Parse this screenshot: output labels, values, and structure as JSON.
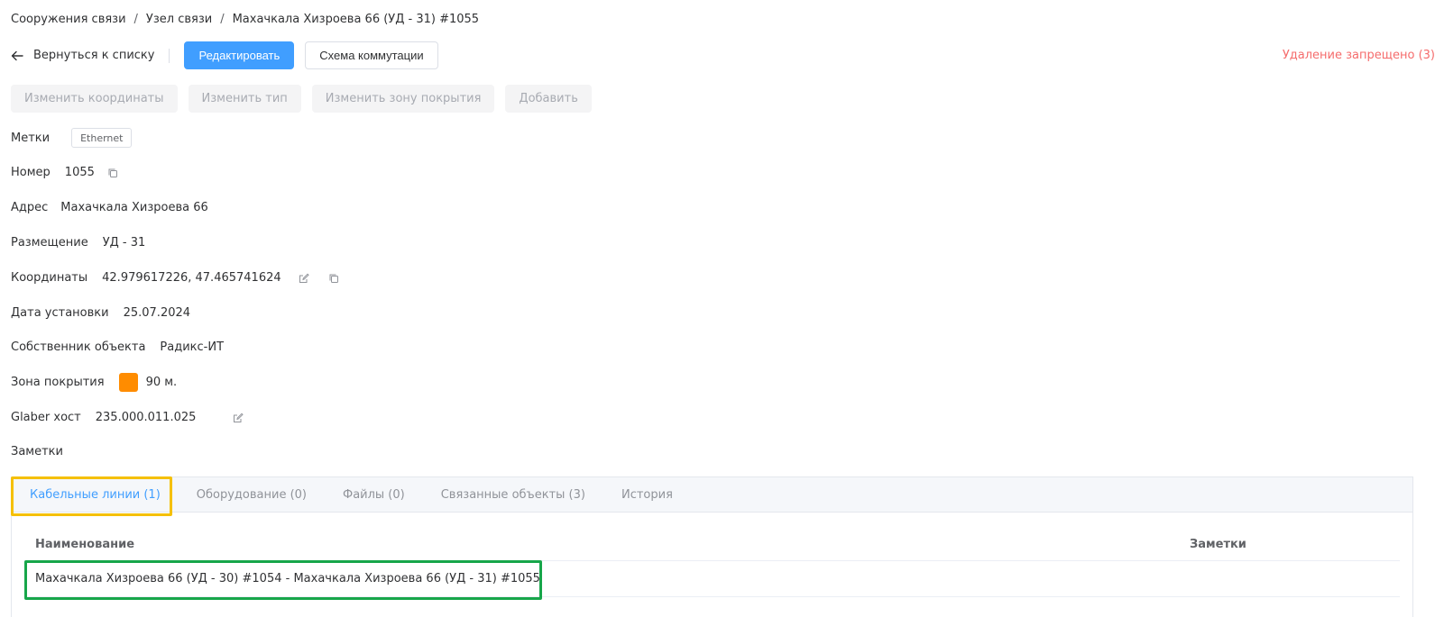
{
  "breadcrumb": {
    "items": [
      "Сооружения связи",
      "Узел связи",
      "Махачкала Хизроева 66 (УД - 31) #1055"
    ],
    "separator": "/"
  },
  "actions": {
    "back_label": "Вернуться к списку",
    "edit_label": "Редактировать",
    "scheme_label": "Схема коммутации",
    "delete_note": "Удаление запрещено (3)"
  },
  "secondary_actions": {
    "change_coords": "Изменить координаты",
    "change_type": "Изменить тип",
    "change_zone": "Изменить зону покрытия",
    "add": "Добавить"
  },
  "fields": {
    "tags": {
      "label": "Метки",
      "value": "Ethernet"
    },
    "number": {
      "label": "Номер",
      "value": "1055"
    },
    "address": {
      "label": "Адрес",
      "value": "Махачкала Хизроева 66"
    },
    "placement": {
      "label": "Размещение",
      "value": "УД - 31"
    },
    "coordinates": {
      "label": "Координаты",
      "value": "42.979617226, 47.465741624"
    },
    "install_date": {
      "label": "Дата установки",
      "value": "25.07.2024"
    },
    "owner": {
      "label": "Собственник объекта",
      "value": "Радикс-ИТ"
    },
    "coverage": {
      "label": "Зона покрытия",
      "value": "90 м.",
      "color": "#ff8c00"
    },
    "glaber_host": {
      "label": "Glaber хост",
      "value": "235.000.011.025"
    },
    "notes": {
      "label": "Заметки",
      "value": ""
    }
  },
  "tabs": [
    {
      "label": "Кабельные линии (1)",
      "active": true
    },
    {
      "label": "Оборудование (0)",
      "active": false
    },
    {
      "label": "Файлы (0)",
      "active": false
    },
    {
      "label": "Связанные объекты (3)",
      "active": false
    },
    {
      "label": "История",
      "active": false
    }
  ],
  "table": {
    "columns": [
      "Наименование",
      "Заметки"
    ],
    "rows": [
      {
        "name": "Махачкала Хизроева 66 (УД - 30) #1054 - Махачкала Хизроева 66 (УД - 31) #1055",
        "notes": ""
      }
    ]
  },
  "icons": {
    "back": "arrow-left-icon",
    "copy": "copy-icon",
    "edit": "edit-icon"
  },
  "colors": {
    "primary": "#409eff",
    "danger": "#f56c6c",
    "highlight_tab": "#f5c000",
    "highlight_row": "#17a64a"
  }
}
